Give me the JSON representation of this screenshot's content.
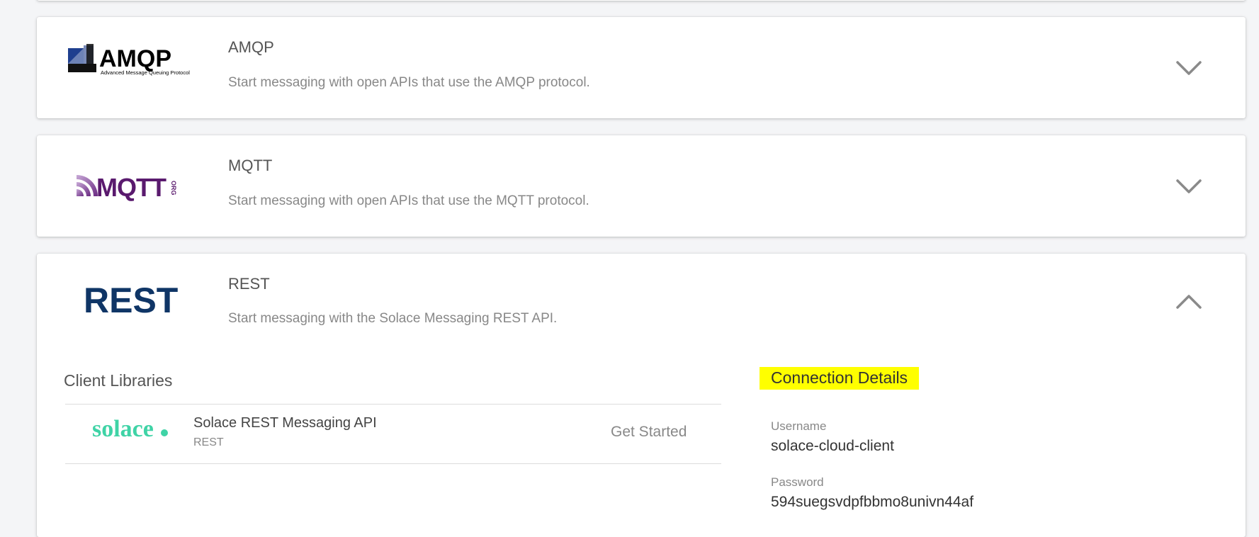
{
  "cards": {
    "amqp": {
      "title": "AMQP",
      "description": "Start messaging with open APIs that use the AMQP protocol.",
      "logo_text": "AMQP",
      "logo_subtext": "Advanced Message Queuing Protocol",
      "logo_icon": "amqp-logo",
      "toggle_icon": "chevron-down-icon"
    },
    "mqtt": {
      "title": "MQTT",
      "description": "Start messaging with open APIs that use the MQTT protocol.",
      "logo_text": "MQTT",
      "logo_subtext": "ORG",
      "logo_icon": "mqtt-logo",
      "toggle_icon": "chevron-down-icon"
    },
    "rest": {
      "title": "REST",
      "description": "Start messaging with the Solace Messaging REST API.",
      "logo_text": "REST",
      "logo_icon": "rest-logo",
      "toggle_icon": "chevron-up-icon",
      "client_libraries": {
        "title": "Client Libraries",
        "items": [
          {
            "logo_text": "solace",
            "name": "Solace REST Messaging API",
            "type": "REST",
            "action_label": "Get Started"
          }
        ]
      },
      "connection_details": {
        "title": "Connection Details",
        "username_label": "Username",
        "username_value": "solace-cloud-client",
        "password_label": "Password",
        "password_value": "594suegsvdpfbbmo8univn44af"
      }
    }
  },
  "colors": {
    "amqp_blue": "#1f3f8f",
    "mqtt_purple": "#5a1a6e",
    "rest_navy": "#0f3566",
    "solace_green": "#3fd3a6",
    "highlight": "#ffff00"
  }
}
